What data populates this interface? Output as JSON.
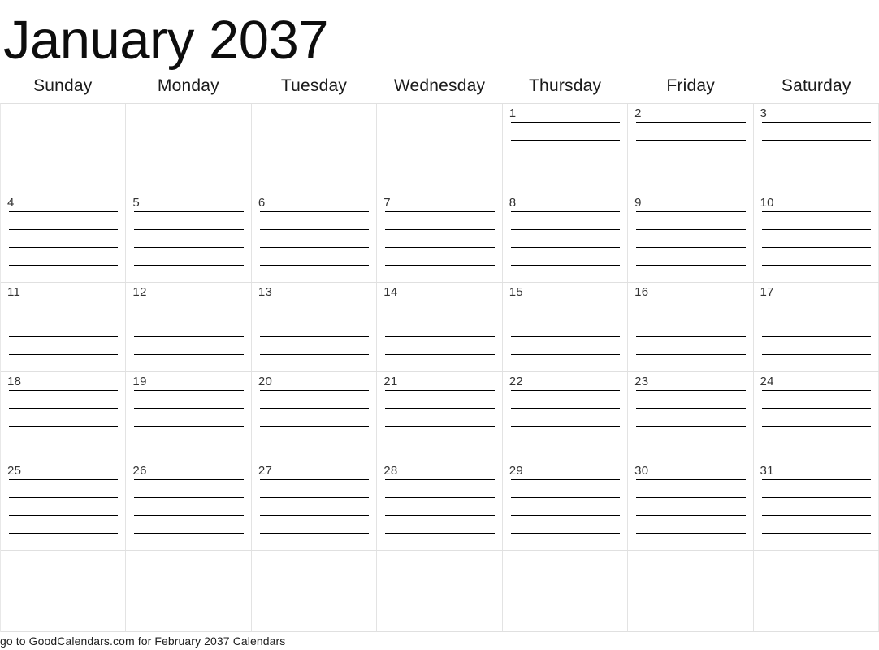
{
  "title": "January 2037",
  "weekdays": [
    "Sunday",
    "Monday",
    "Tuesday",
    "Wednesday",
    "Thursday",
    "Friday",
    "Saturday"
  ],
  "weeks": [
    [
      "",
      "",
      "",
      "",
      "1",
      "2",
      "3"
    ],
    [
      "4",
      "5",
      "6",
      "7",
      "8",
      "9",
      "10"
    ],
    [
      "11",
      "12",
      "13",
      "14",
      "15",
      "16",
      "17"
    ],
    [
      "18",
      "19",
      "20",
      "21",
      "22",
      "23",
      "24"
    ],
    [
      "25",
      "26",
      "27",
      "28",
      "29",
      "30",
      "31"
    ],
    [
      "",
      "",
      "",
      "",
      "",
      "",
      ""
    ]
  ],
  "lines_per_cell": 4,
  "footer": "go to GoodCalendars.com for February 2037 Calendars",
  "colors": {
    "background": "#ffffff",
    "title_text": "#0d0d0d",
    "weekday_text": "#1a1a1a",
    "day_number_text": "#333333",
    "grid_line": "#e0e0e0",
    "write_line": "#000000",
    "footer_text": "#202020"
  }
}
